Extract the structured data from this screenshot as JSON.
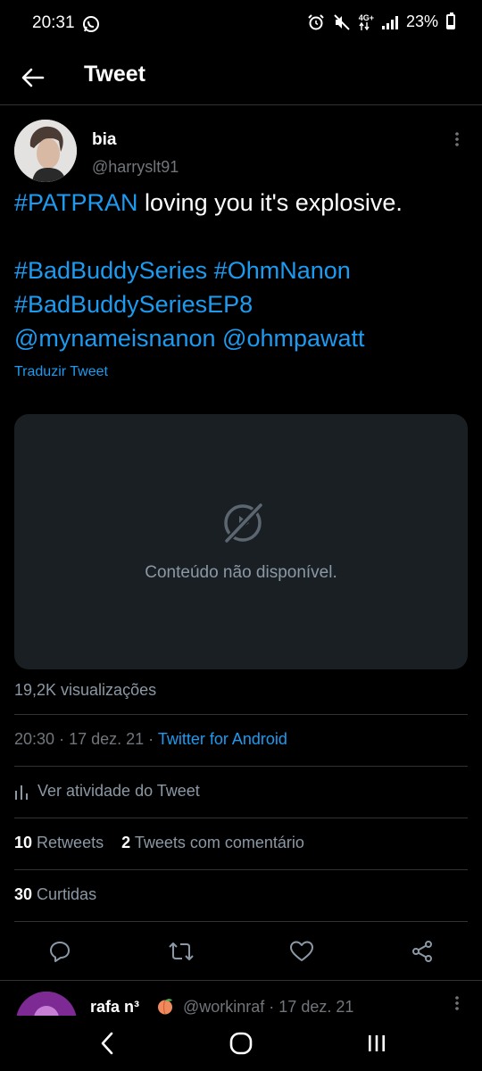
{
  "status_bar": {
    "time": "20:31",
    "network": "4G+",
    "battery": "23%",
    "battery_level": 0.23
  },
  "header": {
    "title": "Tweet"
  },
  "tweet": {
    "author_name": "bia",
    "author_handle": "@harryslt91",
    "text_lines": [
      [
        {
          "text": "#PATPRAN",
          "link": true
        },
        {
          "text": " loving you it's explosive.",
          "link": false
        }
      ],
      [],
      [
        {
          "text": "#BadBuddySeries",
          "link": true
        },
        {
          "text": " ",
          "link": false
        },
        {
          "text": "#OhmNanon",
          "link": true
        }
      ],
      [
        {
          "text": "#BadBuddySeriesEP8",
          "link": true
        }
      ],
      [
        {
          "text": "@mynameisnanon",
          "link": true
        },
        {
          "text": " ",
          "link": false
        },
        {
          "text": "@ohmpawatt",
          "link": true
        }
      ]
    ],
    "translate_label": "Traduzir Tweet",
    "media_unavailable": "Conteúdo não disponível.",
    "views": "19,2K visualizações",
    "time": "20:30",
    "date": "17 dez. 21",
    "source": "Twitter for Android",
    "activity_label": "Ver atividade do Tweet",
    "retweets_count": "10",
    "retweets_label": "Retweets",
    "quotes_count": "2",
    "quotes_label": "Tweets com comentário",
    "likes_count": "30",
    "likes_label": "Curtidas"
  },
  "reply": {
    "name": "rafa n³",
    "handle": "@workinraf",
    "date": "17 dez. 21"
  },
  "colors": {
    "accent": "#1d9bf0",
    "background": "#000000",
    "secondary_text": "#71767b",
    "media_background": "#1a1f24"
  }
}
